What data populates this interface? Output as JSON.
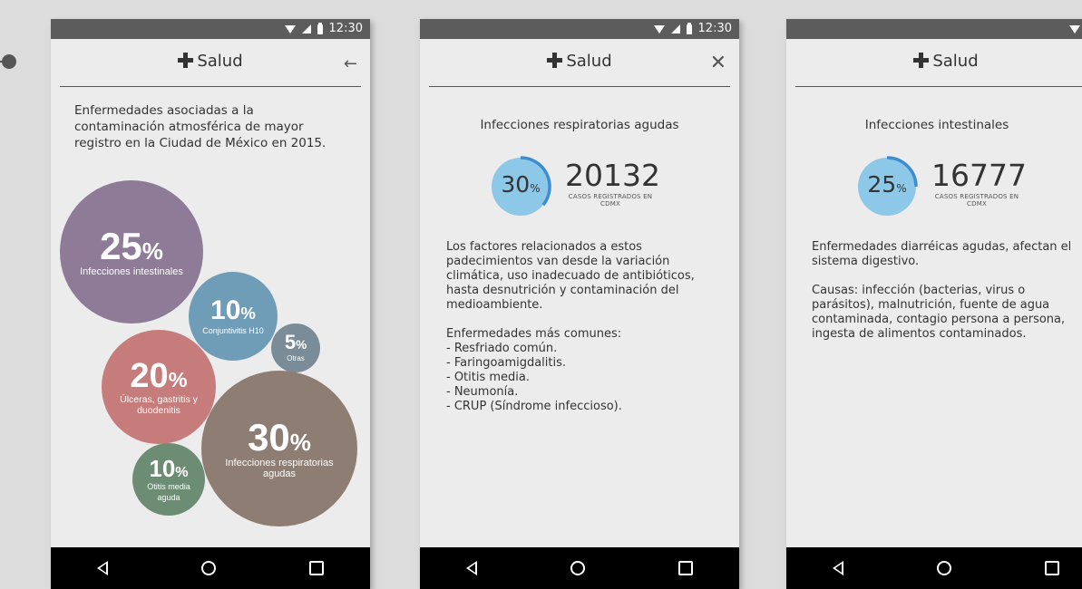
{
  "status": {
    "time": "12:30",
    "time_truncated": "12"
  },
  "app": {
    "name": "Salud"
  },
  "screen1": {
    "intro": "Enfermedades asociadas a la contaminación atmosférica de mayor registro en la Ciudad de México en 2015.",
    "bubbles": [
      {
        "pct": "25",
        "label": "Infecciones intestinales",
        "color": "#8e7b97"
      },
      {
        "pct": "10",
        "label": "Conjuntivitis H10",
        "color": "#6f9cb6"
      },
      {
        "pct": "5",
        "label": "Otras",
        "color": "#7a8c97"
      },
      {
        "pct": "20",
        "label": "Úlceras, gastritis y duodenitis",
        "color": "#c57c7b"
      },
      {
        "pct": "30",
        "label": "Infecciones respiratorias agudas",
        "color": "#8e7d72"
      },
      {
        "pct": "10",
        "label": "Otitis media aguda",
        "color": "#6c8c74"
      }
    ]
  },
  "screen2": {
    "title": "Infecciones respiratorias agudas",
    "percent": "30",
    "percent_unit": "%",
    "count": "20132",
    "caption": "CASOS REGISTRADOS EN CDMX",
    "body": "Los factores relacionados a estos padecimientos van desde la variación climática, uso inadecuado de antibióticos, hasta desnutrición y contaminación del medioambiente.\n\nEnfermedades más comunes:\n- Resfriado común.\n- Faringoamigdalitis.\n- Otitis media.\n- Neumonía.\n- CRUP (Síndrome infeccioso)."
  },
  "screen3": {
    "title": "Infecciones intestinales",
    "percent": "25",
    "percent_unit": "%",
    "count": "16777",
    "caption": "CASOS REGISTRADOS EN CDMX",
    "body": "Enfermedades diarréicas agudas, afectan el sistema digestivo.\n\nCausas: infección (bacterias, virus o parásitos), malnutrición, fuente de agua contaminada, contagio persona a persona, ingesta de alimentos contaminados."
  },
  "colors": {
    "ring_fill": "#8ec8e8",
    "ring_arc": "#3d8ed0",
    "status_bar": "#5c5c5c"
  },
  "icons": {
    "back": "arrow-left-icon",
    "close": "close-icon",
    "brand": "plus-icon"
  }
}
